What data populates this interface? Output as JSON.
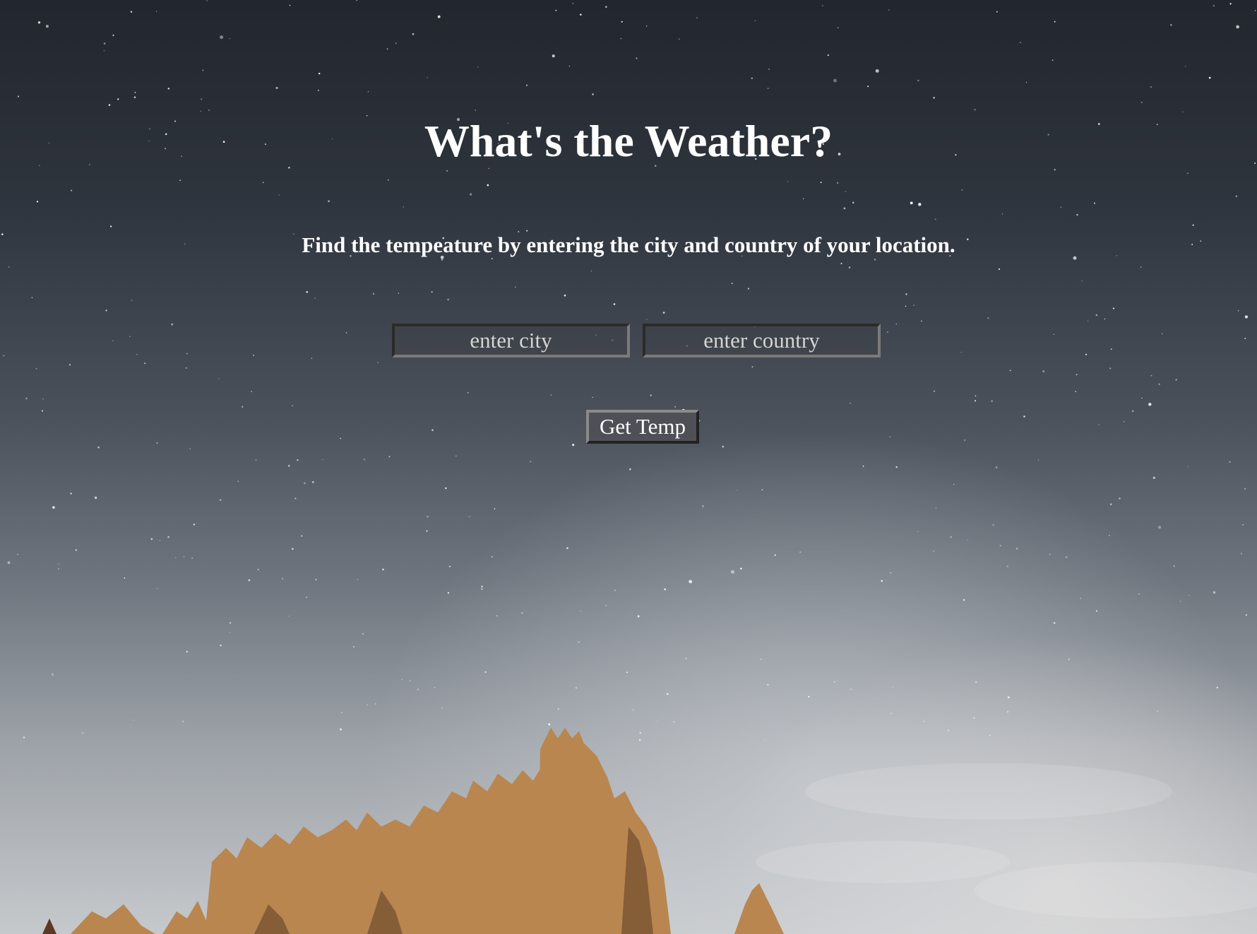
{
  "page": {
    "title": "What's the Weather?",
    "subtitle": "Find the tempeature by entering the city and country of your location."
  },
  "form": {
    "city_placeholder": "enter city",
    "country_placeholder": "enter country",
    "submit_label": "Get Temp"
  },
  "colors": {
    "text": "#ffffff",
    "sky_top": "#22262d",
    "sky_bottom": "#c6c9cc",
    "trees": "#b9864f"
  }
}
